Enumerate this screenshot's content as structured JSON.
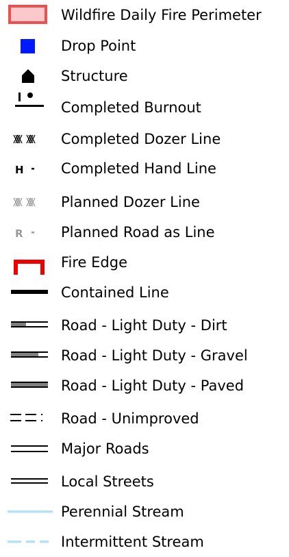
{
  "legend": {
    "items": [
      {
        "label": "Wildfire Daily Fire Perimeter",
        "icon": "fire-perimeter-swatch"
      },
      {
        "label": "Drop Point",
        "icon": "drop-point-square"
      },
      {
        "label": "Structure",
        "icon": "structure-icon"
      },
      {
        "label": "Completed Burnout",
        "icon": "completed-burnout-symbol"
      },
      {
        "label": "Completed Dozer Line",
        "icon": "completed-dozer-line-symbol"
      },
      {
        "label": "Completed Hand Line",
        "icon": "completed-hand-line-symbol"
      },
      {
        "label": "Planned Dozer Line",
        "icon": "planned-dozer-line-symbol"
      },
      {
        "label": "Planned Road as Line",
        "icon": "planned-road-as-line-symbol"
      },
      {
        "label": "Fire Edge",
        "icon": "fire-edge-symbol"
      },
      {
        "label": "Contained Line",
        "icon": "contained-line-symbol"
      },
      {
        "label": "Road - Light Duty - Dirt",
        "icon": "road-dirt-symbol"
      },
      {
        "label": "Road - Light Duty - Gravel",
        "icon": "road-gravel-symbol"
      },
      {
        "label": "Road - Light Duty - Paved",
        "icon": "road-paved-symbol"
      },
      {
        "label": "Road - Unimproved",
        "icon": "road-unimproved-symbol"
      },
      {
        "label": "Major Roads",
        "icon": "major-roads-symbol"
      },
      {
        "label": "Local Streets",
        "icon": "local-streets-symbol"
      },
      {
        "label": "Perennial Stream",
        "icon": "perennial-stream-symbol"
      },
      {
        "label": "Intermittent Stream",
        "icon": "intermittent-stream-symbol"
      }
    ],
    "symbol_text": {
      "hand_line_letter": "H",
      "road_line_letter": "R"
    },
    "colors": {
      "perimeter_fill": "#fbc9cc",
      "perimeter_stroke": "#ef4f4f",
      "drop_point": "#0019ff",
      "fire_edge": "#ee0000",
      "stream": "#b3e3fb",
      "planned_gray": "#9a9a9a",
      "road_gray": "#808080"
    }
  }
}
